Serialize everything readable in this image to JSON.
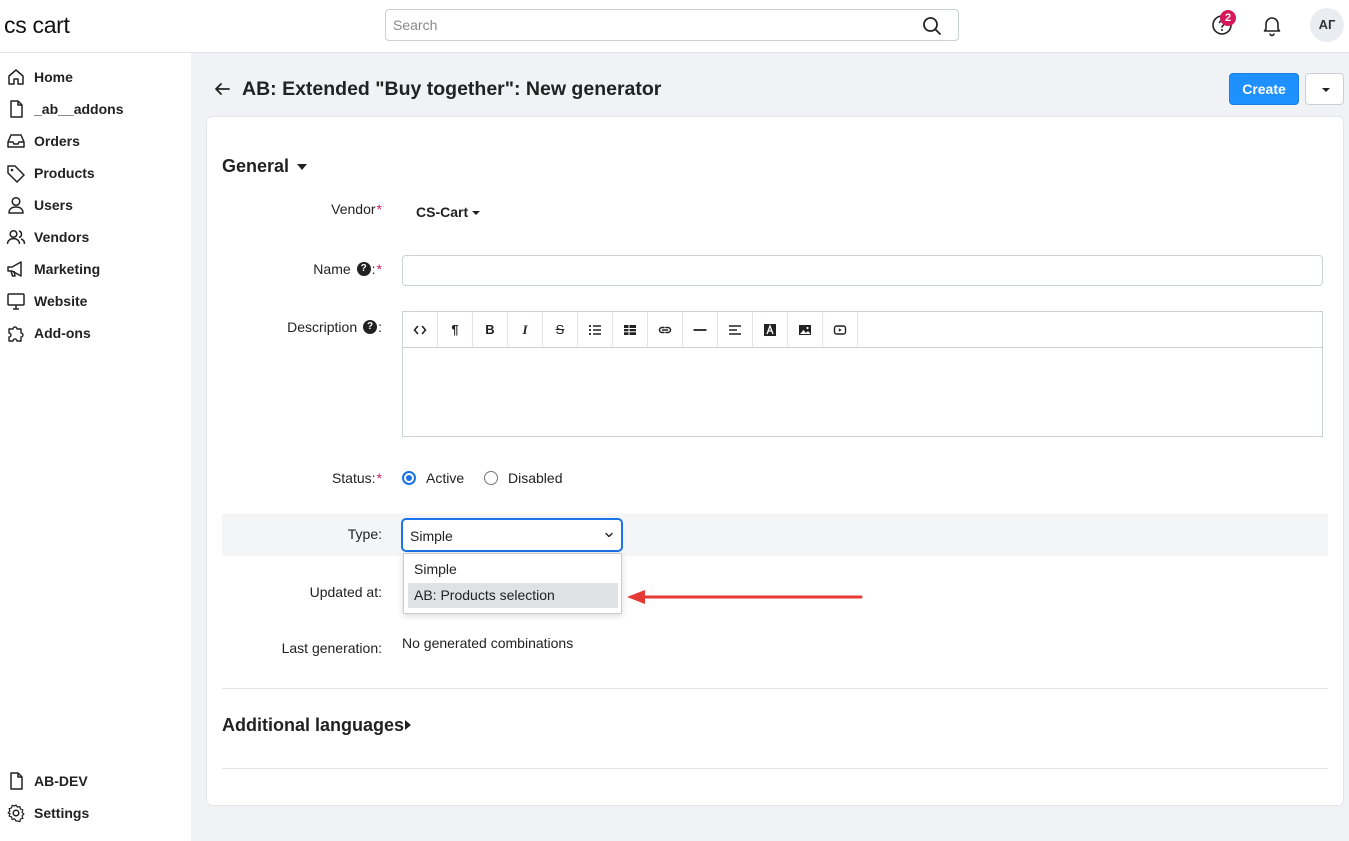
{
  "brand": {
    "logo": "cs cart"
  },
  "search": {
    "placeholder": "Search"
  },
  "topbar": {
    "notification_count": "2",
    "avatar_initials": "АГ"
  },
  "sidebar": {
    "items": [
      {
        "label": "Home",
        "icon": "home-icon"
      },
      {
        "label": "_ab__addons",
        "icon": "file-icon"
      },
      {
        "label": "Orders",
        "icon": "inbox-icon"
      },
      {
        "label": "Products",
        "icon": "tag-icon"
      },
      {
        "label": "Users",
        "icon": "user-icon"
      },
      {
        "label": "Vendors",
        "icon": "users-icon"
      },
      {
        "label": "Marketing",
        "icon": "megaphone-icon"
      },
      {
        "label": "Website",
        "icon": "monitor-icon"
      },
      {
        "label": "Add-ons",
        "icon": "puzzle-icon"
      }
    ],
    "bottom_items": [
      {
        "label": "AB-DEV",
        "icon": "file-icon"
      },
      {
        "label": "Settings",
        "icon": "gear-icon"
      }
    ]
  },
  "header": {
    "title": "AB: Extended \"Buy together\": New generator",
    "create_label": "Create"
  },
  "form": {
    "general_title": "General",
    "vendor_label": "Vendor",
    "vendor_value": "CS-Cart",
    "name_label": "Name",
    "name_value": "",
    "description_label": "Description",
    "required_mark": "*",
    "help_mark": "?",
    "colon": ":",
    "status_label": "Status:",
    "status_options": [
      "Active",
      "Disabled"
    ],
    "status_selected": "Active",
    "type_label": "Type:",
    "type_value": "Simple",
    "type_options": [
      "Simple",
      "AB: Products selection"
    ],
    "type_highlighted": "AB: Products selection",
    "updated_at_label": "Updated at:",
    "last_generation_label": "Last generation:",
    "last_generation_value": "No generated combinations",
    "additional_languages_title": "Additional languages"
  },
  "editor_toolbar": {
    "tools": [
      "code",
      "paragraph",
      "bold",
      "italic",
      "strikethrough",
      "list",
      "table",
      "link",
      "horizontal-rule",
      "align",
      "font-color",
      "image",
      "video"
    ],
    "paragraph_glyph": "¶",
    "bold_glyph": "B",
    "italic_glyph": "I",
    "strike_glyph": "S",
    "font_color_glyph": "A"
  },
  "colors": {
    "accent": "#1e90ff",
    "focus": "#1a73e8",
    "badge": "#d6195a",
    "annotation_arrow": "#e53935"
  }
}
